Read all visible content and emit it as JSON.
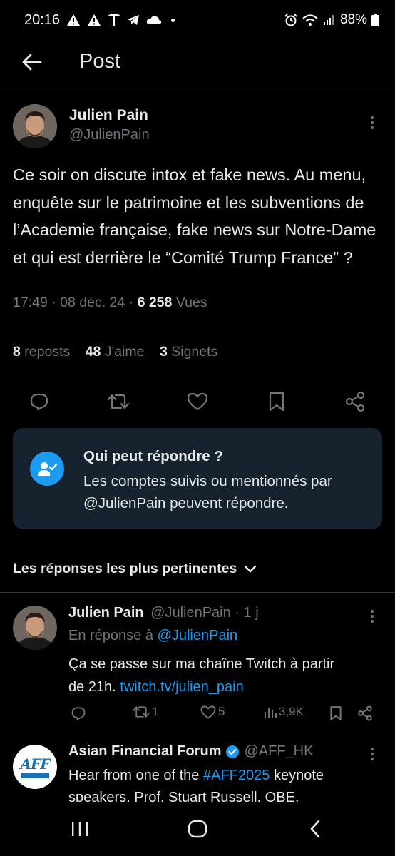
{
  "status_bar": {
    "time": "20:16",
    "battery": "88%"
  },
  "header": {
    "title": "Post"
  },
  "post": {
    "author_name": "Julien Pain",
    "author_handle": "@JulienPain",
    "text": "Ce soir on discute intox et fake news. Au menu, enquête sur le patrimoine et les subventions de l’Academie française, fake news sur Notre-Dame et qui est derrière le “Comité Trump France” ?",
    "time": "17:49",
    "sep1": "·",
    "date": "08 déc. 24",
    "sep2": "·",
    "views_count": "6 258",
    "views_label": "Vues",
    "reposts_count": "8",
    "reposts_label": "reposts",
    "likes_count": "48",
    "likes_label": "J'aime",
    "bookmarks_count": "3",
    "bookmarks_label": "Signets"
  },
  "reply_restriction": {
    "title": "Qui peut répondre ?",
    "body": "Les comptes suivis ou mentionnés par @JulienPain peuvent répondre."
  },
  "replies_filter": {
    "label": "Les réponses les plus pertinentes"
  },
  "replies": [
    {
      "author_name": "Julien Pain",
      "author_handle": "@JulienPain",
      "age": "· 1 j",
      "in_reply_prefix": "En réponse à",
      "in_reply_handle": "@JulienPain",
      "text_line1": "Ça se passe sur ma chaîne Twitch à partir",
      "text_line2_prefix": "de 21h.",
      "link": "twitch.tv/julien_pain",
      "reposts": "1",
      "likes": "5",
      "views": "3,9K"
    },
    {
      "author_name": "Asian Financial Forum",
      "author_handle": "@AFF_HK",
      "avatar_text": "AFF",
      "text_prefix": "Hear from one of the",
      "hashtag": "#AFF2025",
      "text_suffix": "keynote",
      "text_line2": "speakers, Prof. Stuart Russell, OBE,"
    }
  ],
  "colors": {
    "background": "#000000",
    "accent": "#1d9bf0",
    "muted": "#71767b",
    "card": "#16222e",
    "divider": "#2f3336"
  }
}
